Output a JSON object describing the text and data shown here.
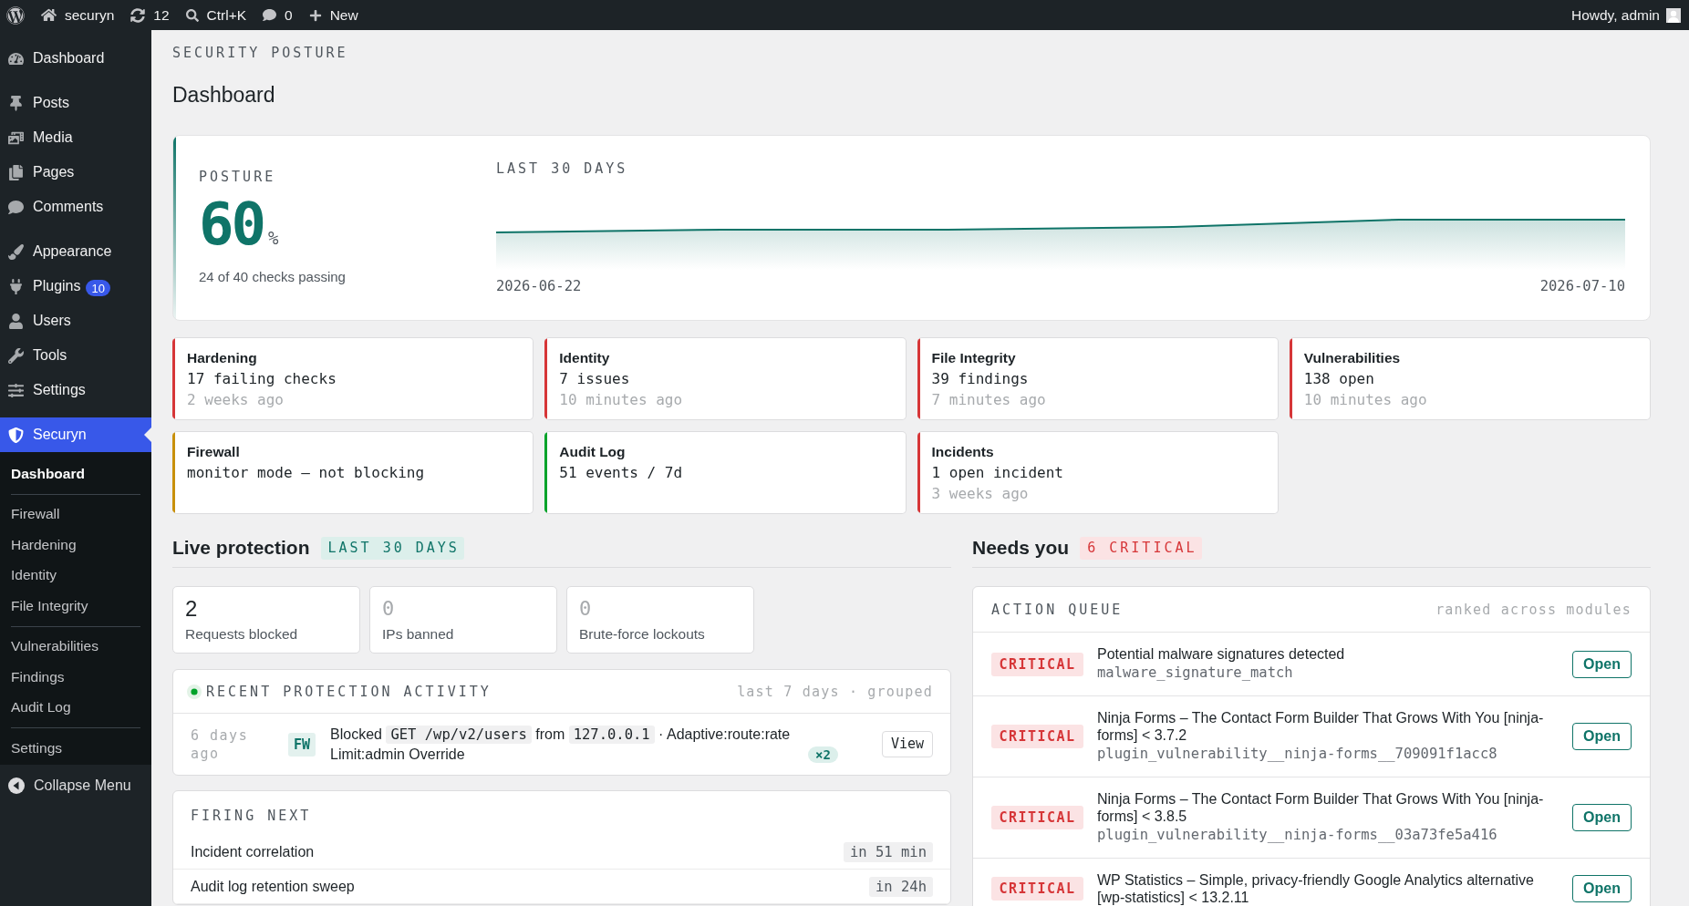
{
  "admin_bar": {
    "site_name": "securyn",
    "updates": "12",
    "search_hint": "Ctrl+K",
    "comments": "0",
    "new_label": "New",
    "greeting": "Howdy, admin"
  },
  "sidebar": {
    "groups": [
      {
        "items": [
          {
            "label": "Dashboard",
            "selected": false
          }
        ]
      },
      {
        "items": [
          {
            "label": "Posts",
            "selected": false
          },
          {
            "label": "Media",
            "selected": false
          },
          {
            "label": "Pages",
            "selected": false
          },
          {
            "label": "Comments",
            "selected": false
          }
        ]
      },
      {
        "items": [
          {
            "label": "Appearance",
            "selected": false
          },
          {
            "label": "Plugins",
            "selected": false,
            "badge": "10"
          },
          {
            "label": "Users",
            "selected": false
          },
          {
            "label": "Tools",
            "selected": false
          },
          {
            "label": "Settings",
            "selected": false
          }
        ]
      },
      {
        "items": [
          {
            "label": "Securyn",
            "selected": true,
            "submenu": [
              {
                "items": [
                  {
                    "label": "Dashboard",
                    "selected": true
                  }
                ]
              },
              {
                "items": [
                  {
                    "label": "Firewall",
                    "selected": false
                  },
                  {
                    "label": "Hardening",
                    "selected": false
                  },
                  {
                    "label": "Identity",
                    "selected": false
                  },
                  {
                    "label": "File Integrity",
                    "selected": false
                  }
                ]
              },
              {
                "items": [
                  {
                    "label": "Vulnerabilities",
                    "selected": false
                  },
                  {
                    "label": "Findings",
                    "selected": false
                  },
                  {
                    "label": "Audit Log",
                    "selected": false
                  }
                ]
              },
              {
                "items": [
                  {
                    "label": "Settings",
                    "selected": false
                  }
                ]
              }
            ]
          }
        ]
      }
    ],
    "collapse_label": "Collapse Menu"
  },
  "page": {
    "eyebrow": "SECURITY POSTURE",
    "title": "Dashboard"
  },
  "posture": {
    "label": "POSTURE",
    "score": "60",
    "unit": "%",
    "caption": "24 of 40 checks passing",
    "trend": {
      "label": "LAST 30 DAYS",
      "start_date": "2026-06-22",
      "end_date": "2026-07-10"
    }
  },
  "modules": [
    {
      "title": "Hardening",
      "summary": "17 failing checks",
      "updated": "2 weeks ago",
      "color": "#d63638"
    },
    {
      "title": "Identity",
      "summary": "7 issues",
      "updated": "10 minutes ago",
      "color": "#d63638"
    },
    {
      "title": "File Integrity",
      "summary": "39 findings",
      "updated": "7 minutes ago",
      "color": "#d63638"
    },
    {
      "title": "Vulnerabilities",
      "summary": "138 open",
      "updated": "10 minutes ago",
      "color": "#d63638"
    },
    {
      "title": "Firewall",
      "summary": "monitor mode — not blocking",
      "color": "#c8900b"
    },
    {
      "title": "Audit Log",
      "summary": "51 events / 7d",
      "color": "#00a32a"
    },
    {
      "title": "Incidents",
      "summary": "1 open incident",
      "updated": "3 weeks ago",
      "color": "#d63638"
    }
  ],
  "live_protection": {
    "title": "Live protection",
    "range": "LAST 30 DAYS",
    "stats": [
      {
        "value": "2",
        "label": "Requests blocked",
        "muted": false
      },
      {
        "value": "0",
        "label": "IPs banned",
        "muted": true
      },
      {
        "value": "0",
        "label": "Brute-force lockouts",
        "muted": true
      }
    ],
    "activity": {
      "title": "RECENT PROTECTION ACTIVITY",
      "live": true,
      "scope": "last 7 days · grouped",
      "events": [
        {
          "when": "6 days ago",
          "source": "FW",
          "parts": [
            {
              "kind": "text",
              "text": "Blocked"
            },
            {
              "kind": "code",
              "text": "GET /wp/v2/users"
            },
            {
              "kind": "text",
              "text": "from"
            },
            {
              "kind": "code",
              "text": "127.0.0.1"
            },
            {
              "kind": "text",
              "text": "· Adaptive:route:rate Limit:admin Override"
            }
          ],
          "count": "×2",
          "action": "View"
        }
      ]
    },
    "schedule": {
      "title": "FIRING NEXT",
      "jobs": [
        {
          "name": "Incident correlation",
          "due": "in 51 min"
        },
        {
          "name": "Audit log retention sweep",
          "due": "in 24h"
        }
      ]
    }
  },
  "needs_you": {
    "title": "Needs you",
    "badge": "6 CRITICAL",
    "queue": {
      "title": "ACTION QUEUE",
      "note": "ranked across modules",
      "items": [
        {
          "severity": "CRITICAL",
          "title": "Potential malware signatures detected",
          "code": "malware_signature_match",
          "action": "Open"
        },
        {
          "severity": "CRITICAL",
          "title": "Ninja Forms – The Contact Form Builder That Grows With You [ninja-forms] < 3.7.2",
          "code": "plugin_vulnerability__ninja-forms__709091f1acc8",
          "action": "Open"
        },
        {
          "severity": "CRITICAL",
          "title": "Ninja Forms – The Contact Form Builder That Grows With You [ninja-forms] < 3.8.5",
          "code": "plugin_vulnerability__ninja-forms__03a73fe5a416",
          "action": "Open"
        },
        {
          "severity": "CRITICAL",
          "title": "WP Statistics – Simple, privacy-friendly Google Analytics alternative [wp-statistics] < 13.2.11",
          "action": "Open"
        }
      ]
    }
  }
}
